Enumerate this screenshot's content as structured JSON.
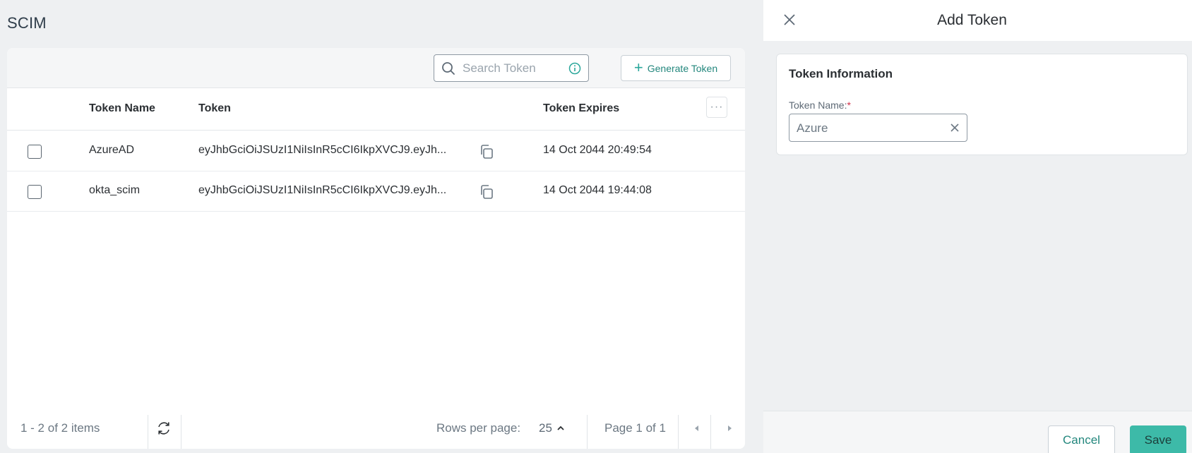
{
  "page": {
    "title": "SCIM"
  },
  "toolbar": {
    "search_placeholder": "Search Token",
    "generate_label": "Generate Token"
  },
  "table": {
    "columns": [
      "Token Name",
      "Token",
      "Token Expires"
    ],
    "rows": [
      {
        "name": "AzureAD",
        "token": "eyJhbGciOiJSUzI1NiIsInR5cCI6IkpXVCJ9.eyJh...",
        "expires": "14 Oct 2044 20:49:54",
        "selected": false
      },
      {
        "name": "okta_scim",
        "token": "eyJhbGciOiJSUzI1NiIsInR5cCI6IkpXVCJ9.eyJh...",
        "expires": "14 Oct 2044 19:44:08",
        "selected": false
      }
    ]
  },
  "footer": {
    "items_summary": "1 - 2 of 2 items",
    "rows_per_page_label": "Rows per page:",
    "rows_per_page_value": "25",
    "page_info": "Page 1 of 1"
  },
  "panel": {
    "title": "Add Token",
    "section_title": "Token Information",
    "field_label": "Token Name:",
    "field_required_mark": "*",
    "field_value": "Azure",
    "cancel_label": "Cancel",
    "save_label": "Save"
  },
  "colors": {
    "accent": "#2aa79b",
    "save_button": "#3dbaa8",
    "required": "#d0314a"
  }
}
